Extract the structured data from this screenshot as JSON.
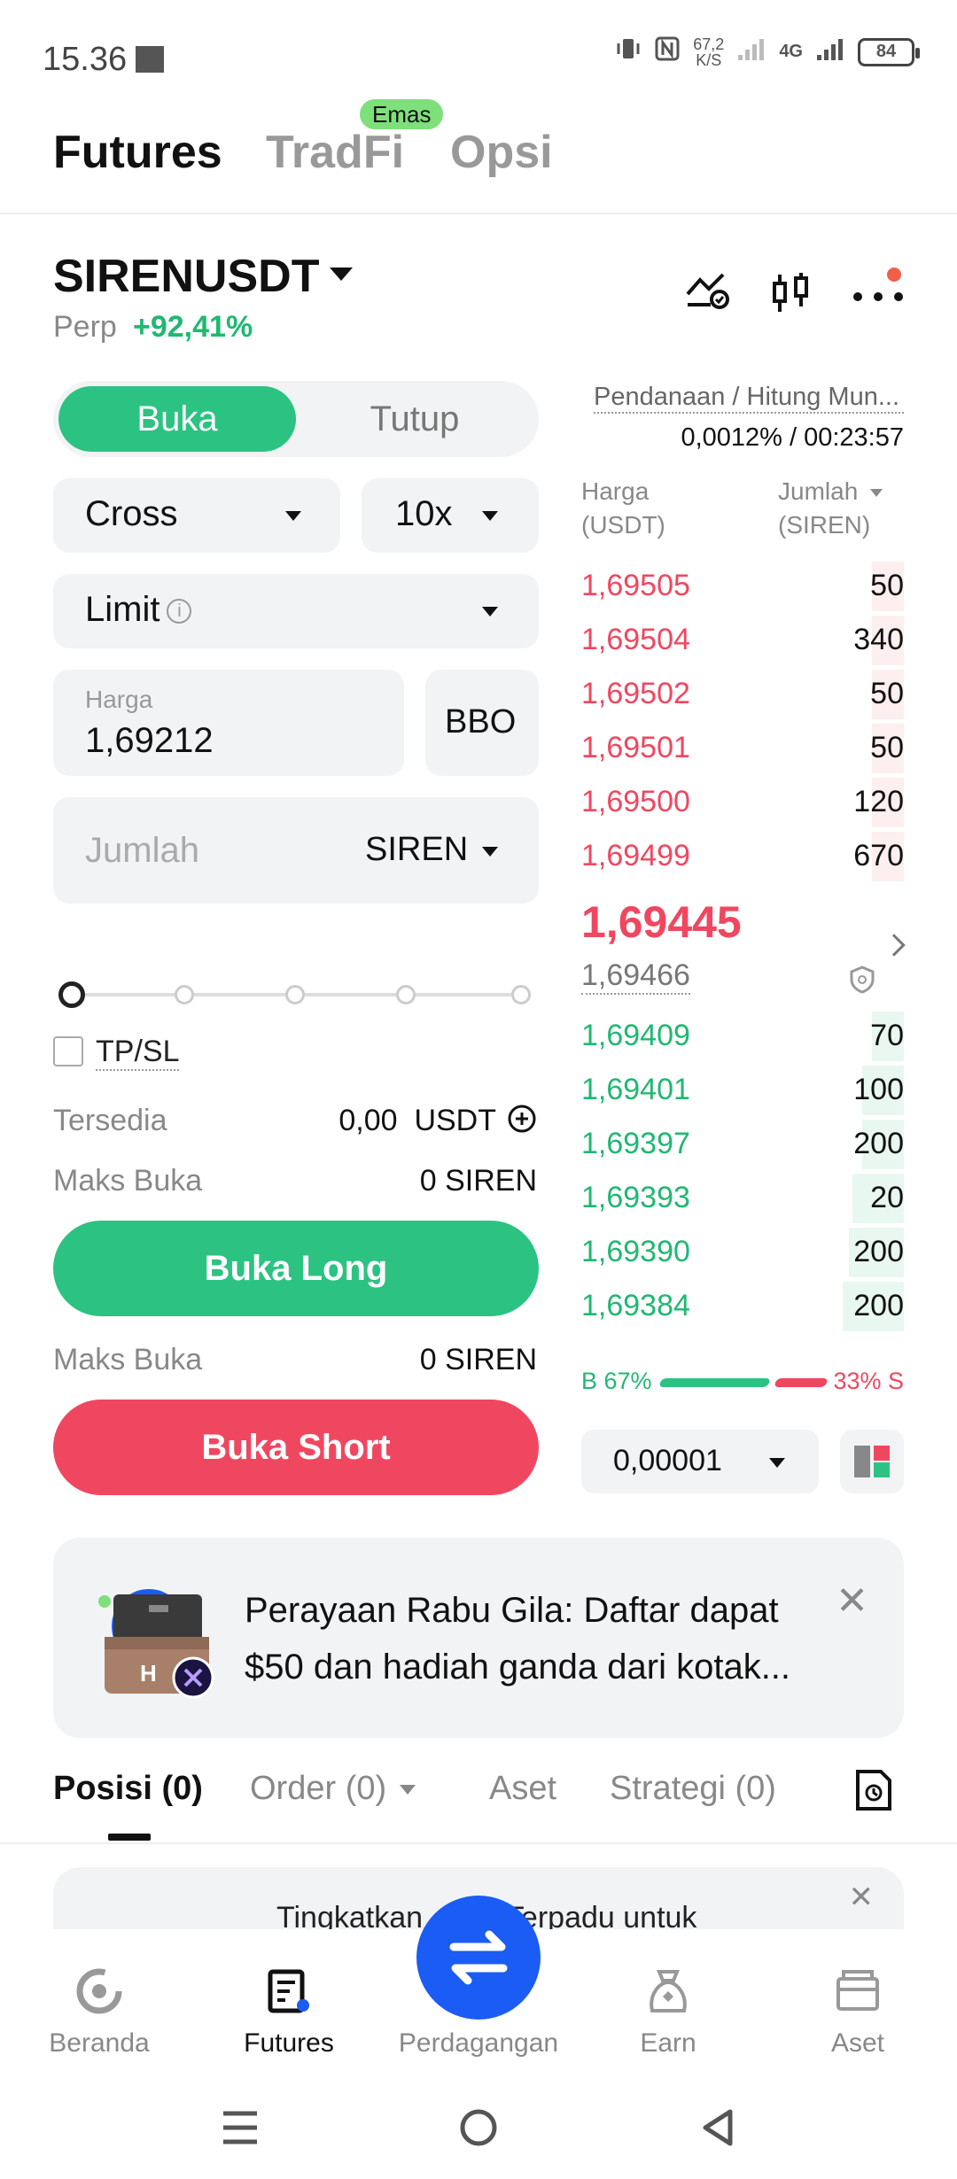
{
  "status_bar": {
    "time": "15.36",
    "net_speed_value": "67,2",
    "net_speed_unit": "K/S",
    "network": "4G",
    "battery": "84"
  },
  "top_tabs": {
    "futures": "Futures",
    "tradfi": "TradFi",
    "opsi": "Opsi",
    "badge": "Emas"
  },
  "symbol": {
    "name": "SIRENUSDT",
    "type": "Perp",
    "change": "+92,41%"
  },
  "form": {
    "open_label": "Buka",
    "close_label": "Tutup",
    "margin_mode": "Cross",
    "leverage": "10x",
    "order_type": "Limit",
    "price_label": "Harga",
    "price_value": "1,69212",
    "bbo_label": "BBO",
    "amount_placeholder": "Jumlah",
    "amount_unit": "SIREN",
    "tpsl_label": "TP/SL",
    "available_label": "Tersedia",
    "available_value": "0,00",
    "available_unit": "USDT",
    "max_open_label": "Maks Buka",
    "max_open_long": "0 SIREN",
    "max_open_short": "0 SIREN",
    "long_button": "Buka Long",
    "short_button": "Buka Short",
    "slider_fraction": 0
  },
  "orderbook": {
    "funding_label": "Pendanaan / Hitung Mun...",
    "funding_value": "0,0012% / 00:23:57",
    "price_header_1": "Harga",
    "price_header_2": "(USDT)",
    "qty_header_1": "Jumlah",
    "qty_header_2": "(SIREN)",
    "asks": [
      {
        "price": "1,69505",
        "qty": "50",
        "depth": 0.1
      },
      {
        "price": "1,69504",
        "qty": "340",
        "depth": 0.1
      },
      {
        "price": "1,69502",
        "qty": "50",
        "depth": 0.1
      },
      {
        "price": "1,69501",
        "qty": "50",
        "depth": 0.1
      },
      {
        "price": "1,69500",
        "qty": "120",
        "depth": 0.1
      },
      {
        "price": "1,69499",
        "qty": "670",
        "depth": 0.1
      }
    ],
    "last_price": "1,69445",
    "mark_price": "1,69466",
    "bids": [
      {
        "price": "1,69409",
        "qty": "70",
        "depth": 0.1
      },
      {
        "price": "1,69401",
        "qty": "100",
        "depth": 0.13
      },
      {
        "price": "1,69397",
        "qty": "200",
        "depth": 0.13
      },
      {
        "price": "1,69393",
        "qty": "20",
        "depth": 0.16
      },
      {
        "price": "1,69390",
        "qty": "200",
        "depth": 0.17
      },
      {
        "price": "1,69384",
        "qty": "200",
        "depth": 0.19
      }
    ],
    "buy_ratio": "B 67%",
    "sell_ratio": "33% S",
    "precision": "0,00001"
  },
  "banner": {
    "text": "Perayaan Rabu Gila: Daftar dapat $50 dan hadiah ganda dari kotak..."
  },
  "bottom_tabs": {
    "positions": "Posisi (0)",
    "orders": "Order (0)",
    "assets": "Aset",
    "strategy": "Strategi (0)"
  },
  "upgrade_banner": {
    "text": "Tingkatkan ... un Terpadu untuk"
  },
  "nav": {
    "home": "Beranda",
    "futures": "Futures",
    "trade": "Perdagangan",
    "earn": "Earn",
    "assets": "Aset"
  },
  "colors": {
    "green": "#2cc382",
    "red": "#f04760",
    "blue": "#1a5cf4"
  }
}
